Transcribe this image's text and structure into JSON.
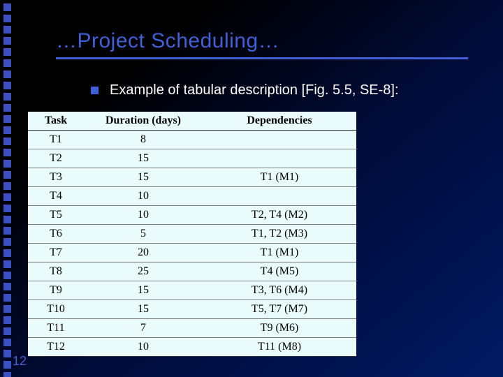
{
  "slide": {
    "title": "…Project Scheduling…",
    "bullet": "Example of tabular description [Fig. 5.5, SE-8]:",
    "page_number": "12"
  },
  "table": {
    "headers": [
      "Task",
      "Duration (days)",
      "Dependencies"
    ],
    "rows": [
      {
        "task": "T1",
        "duration": "8",
        "deps": ""
      },
      {
        "task": "T2",
        "duration": "15",
        "deps": ""
      },
      {
        "task": "T3",
        "duration": "15",
        "deps": "T1 (M1)"
      },
      {
        "task": "T4",
        "duration": "10",
        "deps": ""
      },
      {
        "task": "T5",
        "duration": "10",
        "deps": "T2, T4 (M2)"
      },
      {
        "task": "T6",
        "duration": "5",
        "deps": "T1, T2 (M3)"
      },
      {
        "task": "T7",
        "duration": "20",
        "deps": "T1 (M1)"
      },
      {
        "task": "T8",
        "duration": "25",
        "deps": "T4 (M5)"
      },
      {
        "task": "T9",
        "duration": "15",
        "deps": "T3, T6 (M4)"
      },
      {
        "task": "T10",
        "duration": "15",
        "deps": "T5, T7 (M7)"
      },
      {
        "task": "T11",
        "duration": "7",
        "deps": "T9 (M6)"
      },
      {
        "task": "T12",
        "duration": "10",
        "deps": "T11 (M8)"
      }
    ]
  },
  "decor": {
    "side_square_count": 34
  }
}
